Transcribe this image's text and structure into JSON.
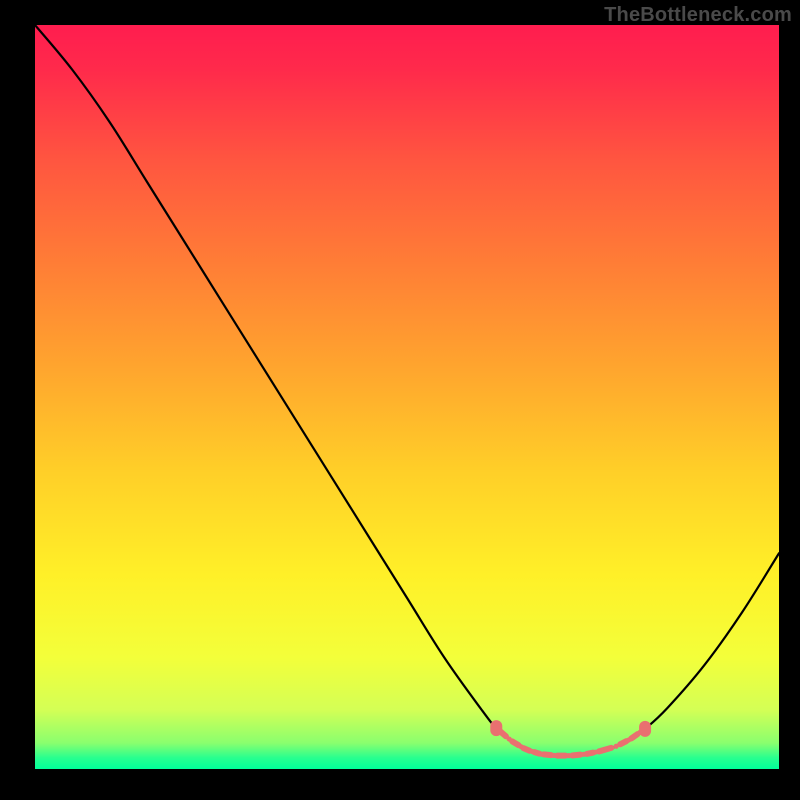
{
  "watermark": "TheBottleneck.com",
  "chart_data": {
    "type": "line",
    "title": "",
    "xlabel": "",
    "ylabel": "",
    "xlim": [
      0,
      100
    ],
    "ylim": [
      0,
      100
    ],
    "curve": {
      "x": [
        0,
        5,
        10,
        15,
        20,
        25,
        30,
        35,
        40,
        45,
        50,
        55,
        60,
        62,
        64,
        66,
        68,
        70,
        72,
        74,
        76,
        78,
        80,
        82,
        85,
        90,
        95,
        100
      ],
      "y": [
        100,
        94,
        87,
        79,
        71,
        63,
        55,
        47,
        39,
        31,
        23,
        15,
        8,
        5.5,
        3.8,
        2.6,
        2.0,
        1.8,
        1.8,
        2.0,
        2.4,
        3.0,
        4.0,
        5.4,
        8.2,
        14.0,
        21.0,
        29.0
      ]
    },
    "marker_band": {
      "x_start": 62,
      "x_end": 82,
      "y": 2.6,
      "segments_x": [
        62,
        64,
        65.5,
        67,
        68.2,
        70,
        72,
        74,
        75.5,
        78.5,
        80,
        81.5
      ]
    },
    "gradient_stops": [
      {
        "offset": 0.0,
        "color": "#ff1d4f"
      },
      {
        "offset": 0.06,
        "color": "#ff2a4b"
      },
      {
        "offset": 0.18,
        "color": "#ff5540"
      },
      {
        "offset": 0.32,
        "color": "#ff7d36"
      },
      {
        "offset": 0.46,
        "color": "#ffa52e"
      },
      {
        "offset": 0.6,
        "color": "#ffcf28"
      },
      {
        "offset": 0.74,
        "color": "#fff028"
      },
      {
        "offset": 0.85,
        "color": "#f3ff3a"
      },
      {
        "offset": 0.92,
        "color": "#d4ff55"
      },
      {
        "offset": 0.965,
        "color": "#8aff6e"
      },
      {
        "offset": 0.985,
        "color": "#28ff8f"
      },
      {
        "offset": 1.0,
        "color": "#00ff99"
      }
    ]
  }
}
